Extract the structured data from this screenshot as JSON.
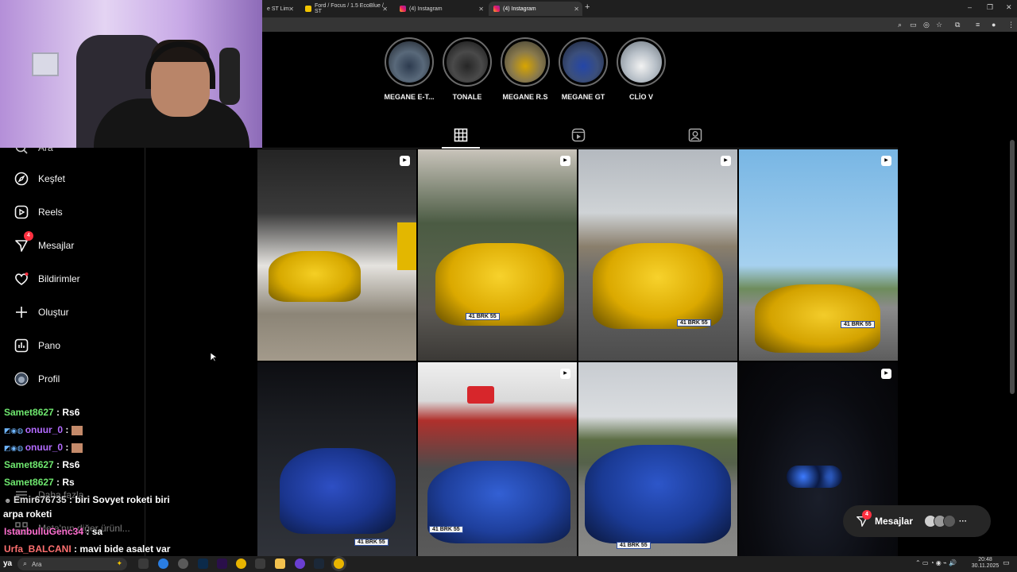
{
  "browser": {
    "tabs": [
      {
        "label": "e ST Lim"
      },
      {
        "label": "Ford / Focus / 1.5 EcoBlue / ST"
      },
      {
        "label": "(4) Instagram"
      },
      {
        "label": "(4) Instagram"
      }
    ],
    "new_tab": "+",
    "win_min": "–",
    "win_max": "❐",
    "win_close": "✕"
  },
  "stories": [
    {
      "label": "MEGANE E-T..."
    },
    {
      "label": "TONALE"
    },
    {
      "label": "MEGANE R.S"
    },
    {
      "label": "MEGANE GT"
    },
    {
      "label": "CLİO V"
    }
  ],
  "sidebar": {
    "partial_item": "Ara",
    "items": [
      {
        "label": "Keşfet",
        "icon": "compass-icon"
      },
      {
        "label": "Reels",
        "icon": "reels-icon"
      },
      {
        "label": "Mesajlar",
        "icon": "messenger-icon",
        "badge": "4"
      },
      {
        "label": "Bildirimler",
        "icon": "heart-icon"
      },
      {
        "label": "Oluştur",
        "icon": "plus-icon"
      },
      {
        "label": "Pano",
        "icon": "dashboard-icon"
      },
      {
        "label": "Profil",
        "icon": "avatar-icon"
      }
    ],
    "more_label": "Daha fazla",
    "also_label": "Meta'nın diğer ürünl..."
  },
  "posts": [
    {
      "plate": "",
      "reel": true
    },
    {
      "plate": "41 BRK 55",
      "reel": true
    },
    {
      "plate": "41 BRK 55",
      "reel": true
    },
    {
      "plate": "41 BRK 55",
      "reel": true
    },
    {
      "plate": "41 BRK 55",
      "reel": false
    },
    {
      "plate": "41 BRK 55",
      "reel": true
    },
    {
      "plate": "41 BRK 55",
      "reel": false
    },
    {
      "plate": "",
      "reel": true
    }
  ],
  "chat": [
    {
      "user": "Samet8627",
      "text": " : Rs6",
      "color": "#6fe86f"
    },
    {
      "user": "onuur_0",
      "text": " : ",
      "color": "#b36bff"
    },
    {
      "user": "onuur_0",
      "text": " : ",
      "color": "#b36bff"
    },
    {
      "user": "Samet8627",
      "text": " : Rs6",
      "color": "#6fe86f"
    },
    {
      "user": "Samet8627",
      "text": " : Rs",
      "color": "#6fe86f"
    },
    {
      "user": "Emir676735",
      "text": " : biri Sovyet roketi biri",
      "color": "#dddddd"
    },
    {
      "user": "",
      "text": "arpa roketi",
      "color": "#ffffff"
    },
    {
      "user": "IstanbulluGenc34",
      "text": " : sa",
      "color": "#ff6fd0"
    },
    {
      "user": "Urfa_BALCANI",
      "text": " : mavi bide asalet var",
      "color": "#ff7070"
    }
  ],
  "messages_pill": {
    "label": "Mesajlar",
    "badge": "4",
    "more": "···"
  },
  "taskbar": {
    "logo": "ya",
    "search_placeholder": "Ara",
    "time": "20:48",
    "date": "30.11.2025"
  },
  "colors": {
    "accent": "#0095f6",
    "badge": "#ff3040",
    "renault_yellow": "#e8b800",
    "renault_blue": "#1f3f9a"
  }
}
